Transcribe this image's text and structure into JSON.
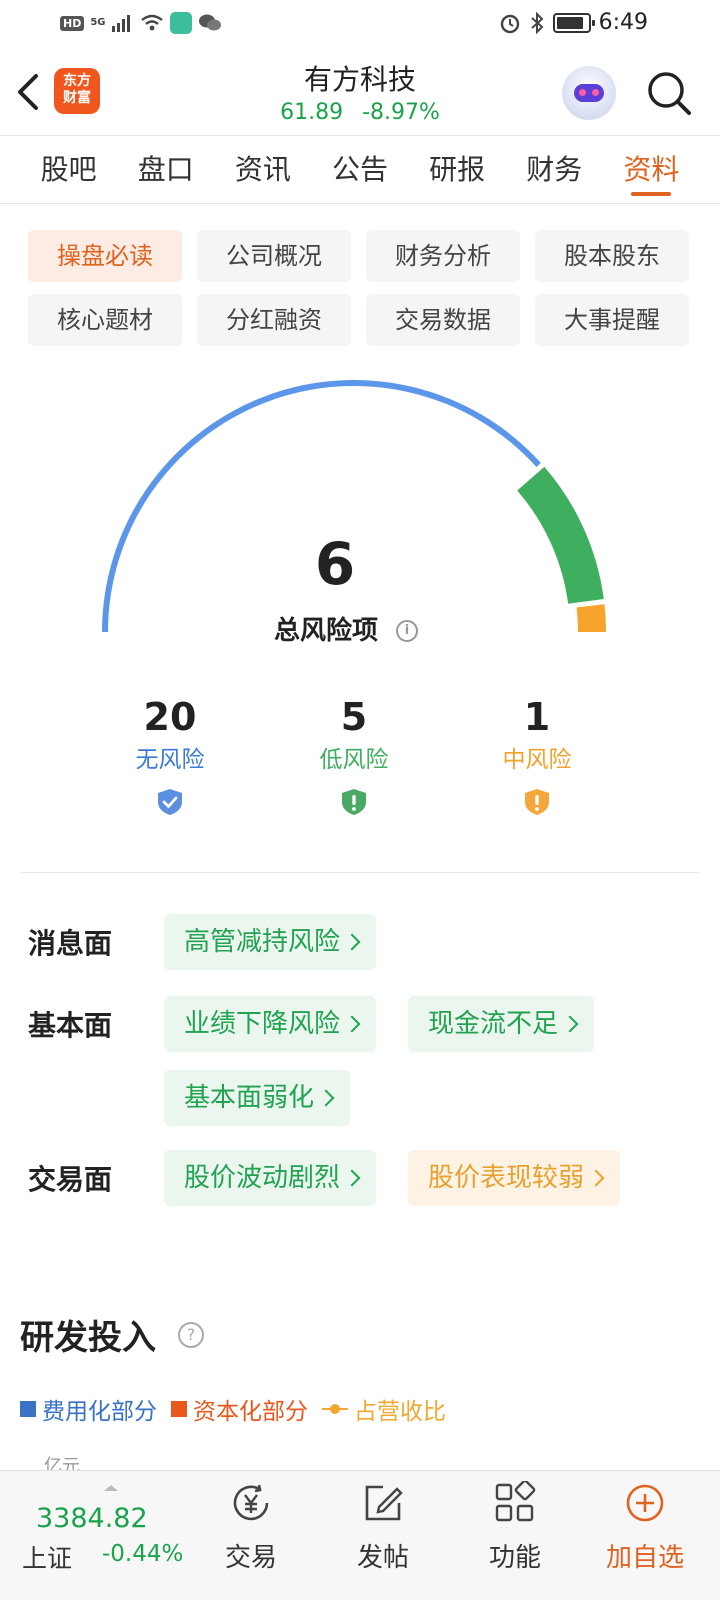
{
  "status_bar": {
    "hd": "HD",
    "network": "5G",
    "time": "6:49"
  },
  "header": {
    "logo_line1": "东方",
    "logo_line2": "财富",
    "stock_name": "有方科技",
    "price": "61.89",
    "change_pct": "-8.97%"
  },
  "tabs": [
    {
      "label": "股吧"
    },
    {
      "label": "盘口"
    },
    {
      "label": "资讯"
    },
    {
      "label": "公告"
    },
    {
      "label": "研报"
    },
    {
      "label": "财务"
    },
    {
      "label": "资料",
      "active": true
    }
  ],
  "sub_categories": [
    {
      "label": "操盘必读",
      "active": true
    },
    {
      "label": "公司概况"
    },
    {
      "label": "财务分析"
    },
    {
      "label": "股本股东"
    },
    {
      "label": "核心题材"
    },
    {
      "label": "分红融资"
    },
    {
      "label": "交易数据"
    },
    {
      "label": "大事提醒"
    }
  ],
  "gauge": {
    "total": "6",
    "label": "总风险项",
    "segments": [
      {
        "name": "无风险",
        "value": 20,
        "color": "#5b96e8"
      },
      {
        "name": "低风险",
        "value": 5,
        "color": "#3daf5e"
      },
      {
        "name": "中风险",
        "value": 1,
        "color": "#f7a42c"
      }
    ]
  },
  "risk_stats": [
    {
      "count": "20",
      "label": "无风险",
      "color": "#3a7bd5",
      "icon": "shield-check-icon"
    },
    {
      "count": "5",
      "label": "低风险",
      "color": "#3daf5e",
      "icon": "shield-alert-icon"
    },
    {
      "count": "1",
      "label": "中风险",
      "color": "#f0a22e",
      "icon": "shield-alert-icon"
    }
  ],
  "risk_factors": {
    "news": {
      "label": "消息面",
      "items": [
        "高管减持风险"
      ]
    },
    "fundamental": {
      "label": "基本面",
      "items": [
        "业绩下降风险",
        "现金流不足",
        "基本面弱化"
      ]
    },
    "trading": {
      "label": "交易面",
      "items": [
        "股价波动剧烈",
        "股价表现较弱"
      ]
    }
  },
  "rd": {
    "title": "研发投入",
    "legend": [
      "费用化部分",
      "资本化部分",
      "占营收比"
    ],
    "legend_colors": [
      "#3a72c4",
      "#e8581c",
      "#f0a830"
    ],
    "unit": "亿元"
  },
  "bottom_nav": {
    "index_value": "3384.82",
    "index_name": "上证",
    "index_change": "-0.44%",
    "items": [
      {
        "label": "交易",
        "icon": "trade-yen-icon"
      },
      {
        "label": "发帖",
        "icon": "compose-icon"
      },
      {
        "label": "功能",
        "icon": "apps-grid-icon"
      },
      {
        "label": "加自选",
        "icon": "add-circle-icon"
      }
    ]
  }
}
